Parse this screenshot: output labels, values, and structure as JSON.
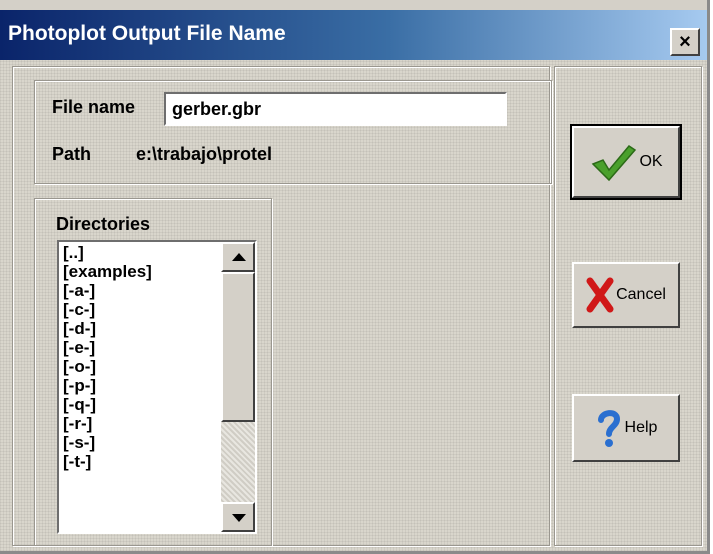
{
  "window": {
    "title": "Photoplot Output File Name",
    "close_glyph": "×"
  },
  "file_group": {
    "file_name_label": "File name",
    "file_name_value": "gerber.gbr",
    "path_label": "Path",
    "path_value": "e:\\trabajo\\protel"
  },
  "directories": {
    "label": "Directories",
    "items": [
      "[..]",
      "[examples]",
      "[-a-]",
      "[-c-]",
      "[-d-]",
      "[-e-]",
      "[-o-]",
      "[-p-]",
      "[-q-]",
      "[-r-]",
      "[-s-]",
      "[-t-]"
    ]
  },
  "buttons": {
    "ok_label": "OK",
    "cancel_label": "Cancel",
    "help_label": "Help"
  },
  "icons": {
    "ok": "checkmark-icon",
    "cancel": "red-x-icon",
    "help": "question-mark-icon"
  },
  "colors": {
    "title_bar_start": "#0a246a",
    "title_bar_end": "#a6caf0",
    "check_green": "#4aa02c",
    "cancel_red": "#d01818",
    "help_blue": "#2a6fd0"
  }
}
